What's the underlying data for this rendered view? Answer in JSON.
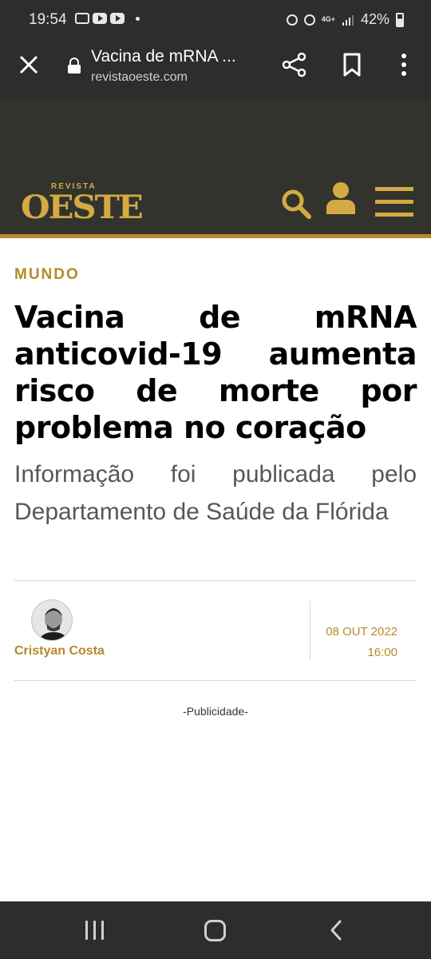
{
  "status_bar": {
    "time": "19:54",
    "left_icons": [
      "gallery-icon",
      "youtube-icon",
      "youtube-icon",
      "dot-icon"
    ],
    "right_icons": [
      "alarm-icon",
      "mute-icon",
      "signal-icon",
      "battery-icon"
    ],
    "network": "4G+",
    "battery": "42%"
  },
  "browser": {
    "title": "Vacina de mRNA ...",
    "url": "revistaoeste.com",
    "icons": [
      "close-icon",
      "lock-icon",
      "share-icon",
      "bookmark-icon",
      "more-vert-icon"
    ]
  },
  "site_header": {
    "logo_small": "REVISTA",
    "logo_big": "OESTE",
    "icons": [
      "search-icon",
      "user-icon",
      "menu-icon"
    ],
    "accent_color": "#b48a2a",
    "background_color": "#32332d"
  },
  "article": {
    "category": "MUNDO",
    "headline": "Vacina de mRNA anticovid-19 aumenta risco de morte por problema no coração",
    "subtitle": "Informação foi publicada pelo Departamento de Saúde da Flórida",
    "author": "Cristyan Costa",
    "date": "08 OUT 2022",
    "time": "16:00",
    "ad_label": "-Publicidade-"
  },
  "nav_bar": {
    "icons": [
      "recents-icon",
      "home-icon",
      "back-icon"
    ]
  }
}
